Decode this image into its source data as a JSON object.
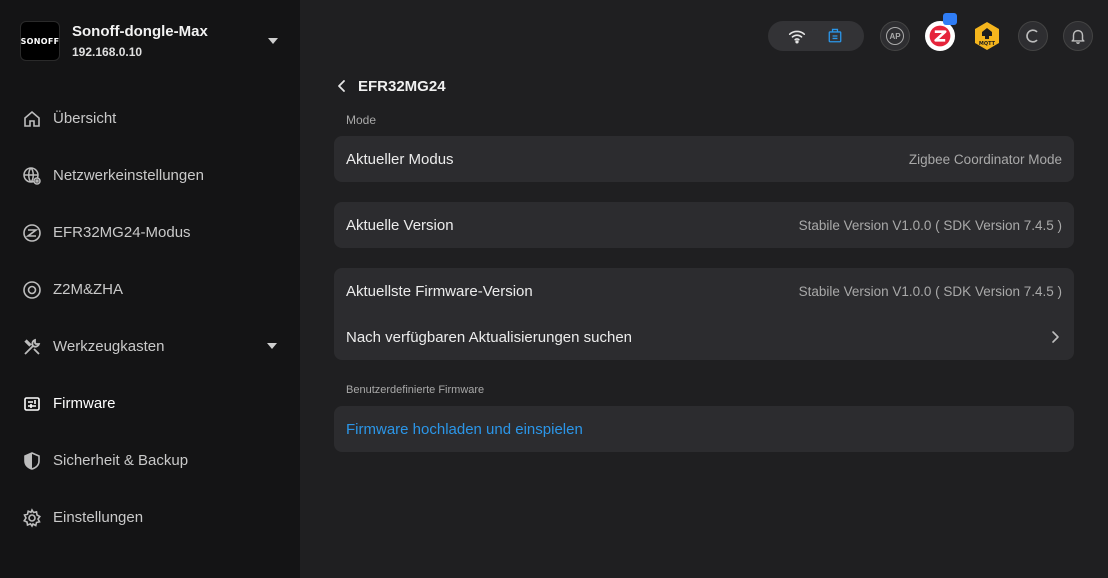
{
  "device": {
    "logo_text": "SONOFF",
    "name": "Sonoff-dongle-Max",
    "ip": "192.168.0.10"
  },
  "nav": {
    "items": [
      {
        "label": "Übersicht",
        "icon": "home-icon"
      },
      {
        "label": "Netzwerkeinstellungen",
        "icon": "globe-settings-icon"
      },
      {
        "label": "EFR32MG24-Modus",
        "icon": "zigbee-icon"
      },
      {
        "label": "Z2M&ZHA",
        "icon": "target-icon"
      },
      {
        "label": "Werkzeugkasten",
        "icon": "tools-icon"
      },
      {
        "label": "Firmware",
        "icon": "firmware-icon"
      },
      {
        "label": "Sicherheit & Backup",
        "icon": "shield-icon"
      },
      {
        "label": "Einstellungen",
        "icon": "gear-icon"
      }
    ],
    "active": "Firmware"
  },
  "topbar": {
    "ap_label": "AP",
    "mqtt_label": "MQTT",
    "accent": "#2b96e8"
  },
  "main": {
    "title": "EFR32MG24",
    "mode_section_label": "Mode",
    "current_mode_label": "Aktueller Modus",
    "current_mode_value": "Zigbee Coordinator Mode",
    "current_version_label": "Aktuelle Version",
    "current_version_value": "Stabile Version V1.0.0 ( SDK Version 7.4.5 )",
    "latest_firmware_label": "Aktuellste Firmware-Version",
    "latest_firmware_value": "Stabile Version V1.0.0 ( SDK Version 7.4.5 )",
    "check_updates_label": "Nach verfügbaren Aktualisierungen suchen",
    "custom_section_label": "Benutzerdefinierte Firmware",
    "upload_link": "Firmware hochladen und einspielen"
  }
}
